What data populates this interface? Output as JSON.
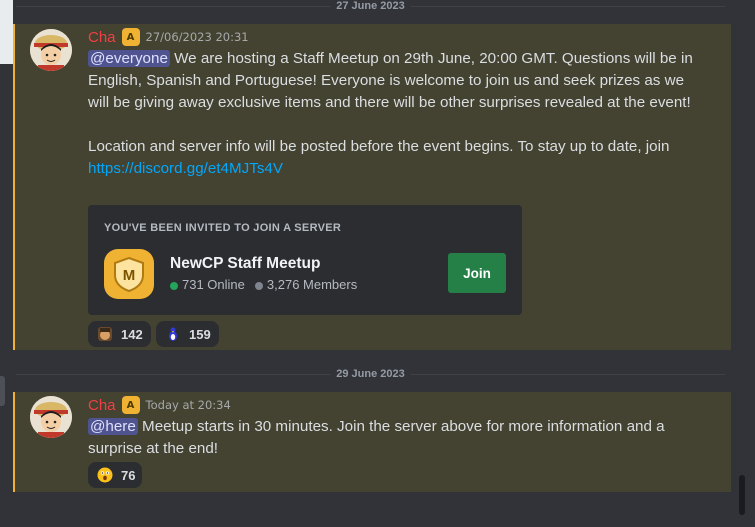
{
  "dividers": [
    "27 June 2023",
    "29 June 2023"
  ],
  "messages": [
    {
      "author": "Cha",
      "badge": "A",
      "timestamp": "27/06/2023 20:31",
      "mention": "@everyone",
      "text": " We are hosting a Staff Meetup on 29th June, 20:00 GMT. Questions will be in English, Spanish and Portuguese! Everyone is welcome to join us and seek prizes as we will be giving away exclusive items and there will be other surprises revealed at the event!",
      "text2": "Location and server info will be posted before the event begins. To stay up to date, join",
      "link": "https://discord.gg/et4MJTs4V",
      "invite": {
        "header": "YOU'VE BEEN INVITED TO JOIN A SERVER",
        "server_name": "NewCP Staff Meetup",
        "online": "731 Online",
        "members": "3,276 Members",
        "join_label": "Join",
        "icon_letter": "M"
      },
      "reactions": [
        {
          "emoji": "custom-face-emoji",
          "count": "142"
        },
        {
          "emoji": "custom-penguin-emoji",
          "count": "159"
        }
      ]
    },
    {
      "author": "Cha",
      "badge": "A",
      "timestamp": "Today at 20:34",
      "mention": "@here",
      "text": " Meetup starts in 30 minutes. Join the server above for more information and a surprise at the end!",
      "reactions": [
        {
          "emoji": "hushed-face-emoji",
          "count": "76"
        }
      ]
    }
  ],
  "colors": {
    "background": "#313338",
    "highlight": "#444231",
    "highlight_border": "#f0b232",
    "author": "#f23f43",
    "mention_bg": "#4f5490",
    "link": "#00a8fc",
    "join": "#248046",
    "online": "#23a55a",
    "members": "#80848e"
  }
}
